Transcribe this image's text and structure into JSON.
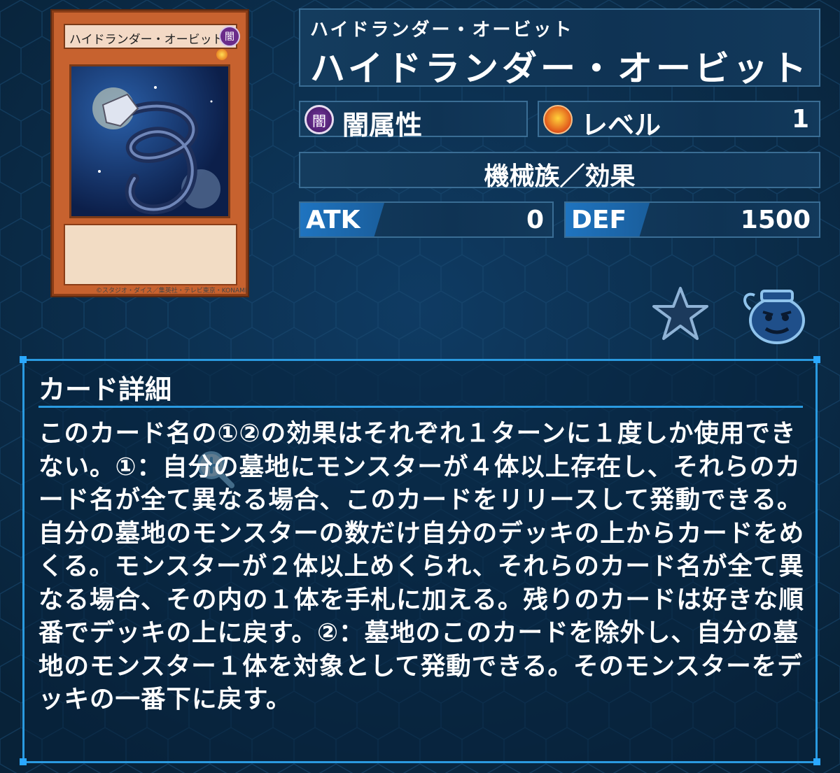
{
  "card_image": {
    "name": "ハイドランダー・オービット",
    "attribute_glyph": "闇",
    "copyright": "©スタジオ・ダイス／集英社・テレビ東京・KONAMI"
  },
  "card": {
    "name_ruby": "ハイドランダー・オービット",
    "name": "ハイドランダー・オービット",
    "attribute_icon_glyph": "闇",
    "attribute": "闇属性",
    "level_label": "レベル",
    "level": "1",
    "type": "機械族／効果",
    "atk_label": "ATK",
    "atk": "0",
    "def_label": "DEF",
    "def": "1500"
  },
  "actions": {
    "favorite_icon": "star-icon",
    "pot_icon": "pot-of-greed-icon",
    "zoom_icon": "zoom-in-icon"
  },
  "detail": {
    "title": "カード詳細",
    "text": "このカード名の①②の効果はそれぞれ１ターンに１度しか使用できない。①：自分の墓地にモンスターが４体以上存在し、それらのカード名が全て異なる場合、このカードをリリースして発動できる。自分の墓地のモンスターの数だけ自分のデッキの上からカードをめくる。モンスターが２体以上めくられ、それらのカード名が全て異なる場合、その内の１体を手札に加える。残りのカードは好きな順番でデッキの上に戻す。②：墓地のこのカードを除外し、自分の墓地のモンスター１体を対象として発動できる。そのモンスターをデッキの一番下に戻す。"
  },
  "colors": {
    "background": "#0b2c4a",
    "panel": "#12395b",
    "panel_border": "#3a6d94",
    "accent": "#2a9ae0",
    "stat_tag": "#1f74c0",
    "card_frame": "#c7622f",
    "dark_attribute": "#6a2c8a"
  }
}
